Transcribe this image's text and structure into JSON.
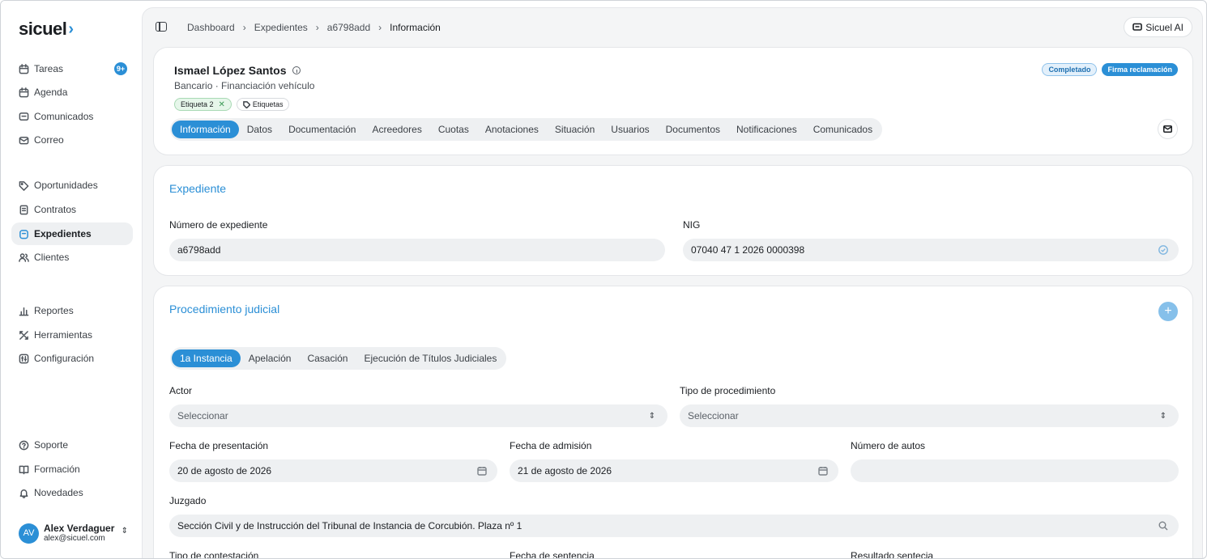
{
  "brand": {
    "name": "sicuel",
    "mark": "›"
  },
  "sidebar": {
    "items": [
      {
        "label": "Tareas",
        "icon": "calendar-check-icon",
        "badge": "9+"
      },
      {
        "label": "Agenda",
        "icon": "calendar-icon"
      },
      {
        "label": "Comunicados",
        "icon": "message-icon"
      },
      {
        "label": "Correo",
        "icon": "mail-icon"
      },
      {
        "label": "Oportunidades",
        "icon": "tag-icon"
      },
      {
        "label": "Contratos",
        "icon": "document-icon"
      },
      {
        "label": "Expedientes",
        "icon": "folder-icon",
        "active": true
      },
      {
        "label": "Clientes",
        "icon": "users-icon"
      },
      {
        "label": "Reportes",
        "icon": "chart-icon"
      },
      {
        "label": "Herramientas",
        "icon": "tools-icon"
      },
      {
        "label": "Configuración",
        "icon": "settings-icon"
      },
      {
        "label": "Soporte",
        "icon": "help-icon"
      },
      {
        "label": "Formación",
        "icon": "book-icon"
      },
      {
        "label": "Novedades",
        "icon": "bell-icon"
      }
    ],
    "user": {
      "initials": "AV",
      "name": "Alex Verdaguer",
      "email": "alex@sicuel.com"
    }
  },
  "breadcrumb": [
    "Dashboard",
    "Expedientes",
    "a6798add",
    "Información"
  ],
  "ai_button": "Sicuel AI",
  "header": {
    "client_name": "Ismael López Santos",
    "subtitle": "Bancario · Financiación vehículo",
    "tags": [
      "Etiqueta 2"
    ],
    "tags_button": "Etiquetas",
    "status": [
      "Completado",
      "Firma reclamación"
    ],
    "tabs": [
      "Información",
      "Datos",
      "Documentación",
      "Acreedores",
      "Cuotas",
      "Anotaciones",
      "Situación",
      "Usuarios",
      "Documentos",
      "Notificaciones",
      "Comunicados"
    ]
  },
  "expediente": {
    "title": "Expediente",
    "numero_label": "Número de expediente",
    "numero_value": "a6798add",
    "nig_label": "NIG",
    "nig_value": "07040 47 1 2026 0000398"
  },
  "procedimiento": {
    "title": "Procedimiento judicial",
    "subtabs": [
      "1a Instancia",
      "Apelación",
      "Casación",
      "Ejecución de Títulos Judiciales"
    ],
    "actor_label": "Actor",
    "actor_value": "Seleccionar",
    "tipo_label": "Tipo de procedimiento",
    "tipo_value": "Seleccionar",
    "fecha_pres_label": "Fecha de presentación",
    "fecha_pres_value": "20 de agosto de 2026",
    "fecha_adm_label": "Fecha de admisión",
    "fecha_adm_value": "21 de agosto de 2026",
    "autos_label": "Número de autos",
    "autos_value": "",
    "juzgado_label": "Juzgado",
    "juzgado_value": "Sección Civil y de Instrucción del Tribunal de Instancia de Corcubión. Plaza nº 1",
    "contestacion_label": "Tipo de contestación",
    "fecha_sentencia_label": "Fecha de sentencia",
    "resultado_label": "Resultado sentecia"
  },
  "colors": {
    "accent": "#2b8fd6",
    "panel": "#f4f5f6",
    "field": "#eef0f2"
  }
}
